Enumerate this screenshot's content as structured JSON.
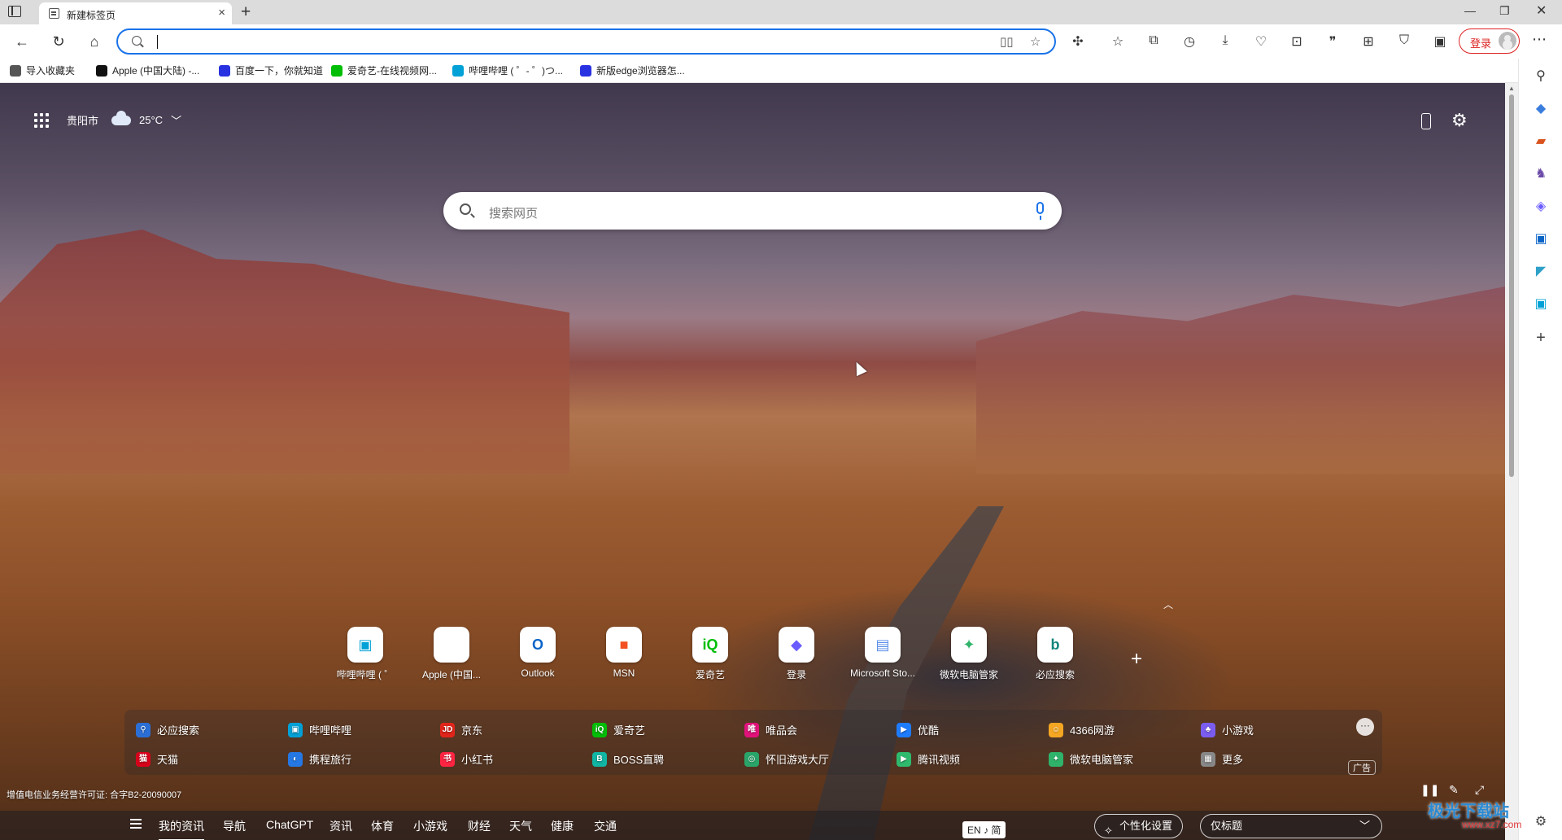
{
  "browser": {
    "tab_title": "新建标签页",
    "new_tab": "+",
    "address_value": "",
    "login_label": "登录"
  },
  "bookmarks": [
    {
      "label": "导入收藏夹",
      "icon": "import-icon",
      "color": "#555555"
    },
    {
      "label": "Apple (中国大陆) -...",
      "icon": "apple-icon",
      "color": "#111111"
    },
    {
      "label": "百度一下，你就知道",
      "icon": "baidu-icon",
      "color": "#2932e1"
    },
    {
      "label": "爱奇艺-在线视频网...",
      "icon": "iqiyi-icon",
      "color": "#00be06"
    },
    {
      "label": "哔哩哔哩 ( ゜- ゜)つ...",
      "icon": "bilibili-icon",
      "color": "#00a1d6"
    },
    {
      "label": "新版edge浏览器怎...",
      "icon": "baidu-icon",
      "color": "#2932e1"
    }
  ],
  "weather": {
    "city": "贵阳市",
    "temp": "25°C"
  },
  "search": {
    "placeholder": "搜索网页"
  },
  "quick_links": [
    {
      "label": "哔哩哔哩 ( ゜",
      "icon": "bilibili-icon",
      "glyph": "▣",
      "color": "#00a1d6"
    },
    {
      "label": "Apple (中国...",
      "icon": "apple-icon",
      "glyph": "",
      "color": "#111111"
    },
    {
      "label": "Outlook",
      "icon": "outlook-icon",
      "glyph": "O",
      "color": "#0a64c8"
    },
    {
      "label": "MSN",
      "icon": "microsoft-icon",
      "glyph": "■",
      "color": "#f25022"
    },
    {
      "label": "爱奇艺",
      "icon": "iqiyi-icon",
      "glyph": "iQ",
      "color": "#00be06"
    },
    {
      "label": "登录",
      "icon": "copilot-icon",
      "glyph": "◆",
      "color": "#6a5cff"
    },
    {
      "label": "Microsoft Sto...",
      "icon": "store-icon",
      "glyph": "▤",
      "color": "#5a8ee8"
    },
    {
      "label": "微软电脑管家",
      "icon": "pc-manager-icon",
      "glyph": "✦",
      "color": "#2fb36a"
    },
    {
      "label": "必应搜索",
      "icon": "bing-icon",
      "glyph": "b",
      "color": "#12857a"
    }
  ],
  "nav_links": [
    {
      "label": "必应搜索",
      "icon": "search-icon",
      "glyph": "⚲",
      "color": "#2b6fd6"
    },
    {
      "label": "哔哩哔哩",
      "icon": "bilibili-icon",
      "glyph": "▣",
      "color": "#00a1d6"
    },
    {
      "label": "京东",
      "icon": "jd-icon",
      "glyph": "JD",
      "color": "#e1251b"
    },
    {
      "label": "爱奇艺",
      "icon": "iqiyi-icon",
      "glyph": "iQ",
      "color": "#00be06"
    },
    {
      "label": "唯品会",
      "icon": "vip-icon",
      "glyph": "唯",
      "color": "#e2127b"
    },
    {
      "label": "优酷",
      "icon": "youku-icon",
      "glyph": "▶",
      "color": "#1f7cff"
    },
    {
      "label": "4366网游",
      "icon": "4366-icon",
      "glyph": "☺",
      "color": "#f5a623"
    },
    {
      "label": "小游戏",
      "icon": "game-icon",
      "glyph": "♣",
      "color": "#7a5cf0"
    },
    {
      "label": "天猫",
      "icon": "tmall-icon",
      "glyph": "猫",
      "color": "#d9001b"
    },
    {
      "label": "携程旅行",
      "icon": "ctrip-icon",
      "glyph": "◐",
      "color": "#2577e3"
    },
    {
      "label": "小红书",
      "icon": "xiaohongshu-icon",
      "glyph": "书",
      "color": "#ff2442"
    },
    {
      "label": "BOSS直聘",
      "icon": "boss-icon",
      "glyph": "B",
      "color": "#11b5a4"
    },
    {
      "label": "怀旧游戏大厅",
      "icon": "retro-game-icon",
      "glyph": "◎",
      "color": "#2aa56a"
    },
    {
      "label": "腾讯视频",
      "icon": "tencent-video-icon",
      "glyph": "▶",
      "color": "#2fba6e"
    },
    {
      "label": "微软电脑管家",
      "icon": "pc-manager-icon",
      "glyph": "✦",
      "color": "#2fb36a"
    },
    {
      "label": "更多",
      "icon": "more-icon",
      "glyph": "▦",
      "color": "#888888"
    }
  ],
  "ad_badge": "广告",
  "license": "增值电信业务经营许可证: 合字B2-20090007",
  "news_tabs": [
    "我的资讯",
    "导航",
    "ChatGPT",
    "资讯",
    "体育",
    "小游戏",
    "财经",
    "天气",
    "健康",
    "交通"
  ],
  "ime": "EN ♪ 简",
  "personalize_label": "个性化设置",
  "view_select": "仅标题",
  "watermark": {
    "title": "极光下载站",
    "url": "www.xz7.com"
  }
}
